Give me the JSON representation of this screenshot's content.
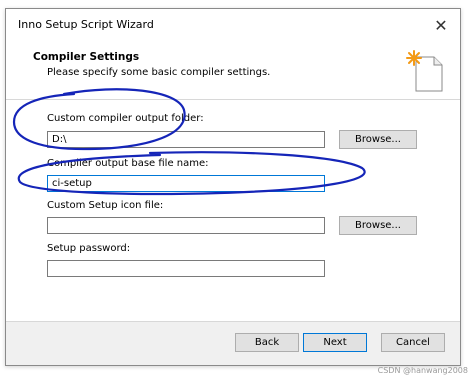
{
  "window": {
    "title": "Inno Setup Script Wizard"
  },
  "header": {
    "title": "Compiler Settings",
    "subtitle": "Please specify some basic compiler settings."
  },
  "fields": {
    "output_folder": {
      "label": "Custom compiler output folder:",
      "value": "D:\\"
    },
    "base_filename": {
      "label": "Compiler output base file name:",
      "value": "ci-setup"
    },
    "setup_icon": {
      "label": "Custom Setup icon file:",
      "value": ""
    },
    "password": {
      "label": "Setup password:",
      "value": ""
    }
  },
  "buttons": {
    "browse": "Browse...",
    "back": "Back",
    "next": "Next",
    "cancel": "Cancel"
  },
  "icons": {
    "close": "close-icon",
    "wizard": "wizard-document-icon"
  },
  "watermark": "CSDN @hanwang2008",
  "colors": {
    "annotation_stroke": "#1525b8",
    "accent_border": "#0078d7",
    "footer_bg": "#f0f0f0"
  }
}
